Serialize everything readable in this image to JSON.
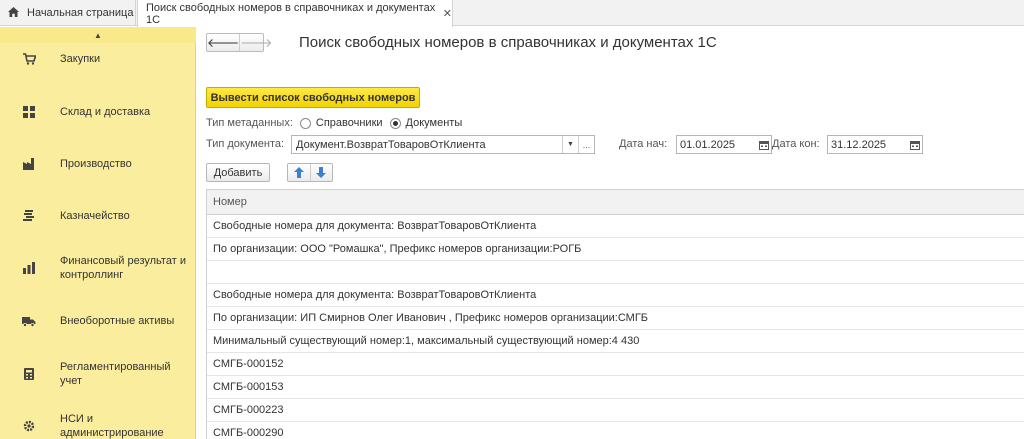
{
  "tabs": {
    "home_label": "Начальная страница",
    "active_label": "Поиск свободных номеров в  справочниках и документах 1С"
  },
  "sidebar": {
    "items": [
      {
        "label": "Закупки",
        "icon": "cart-icon"
      },
      {
        "label": "Склад и доставка",
        "icon": "warehouse-icon"
      },
      {
        "label": "Производство",
        "icon": "factory-icon"
      },
      {
        "label": "Казначейство",
        "icon": "coins-icon"
      },
      {
        "label": "Финансовый результат и контроллинг",
        "icon": "chart-icon"
      },
      {
        "label": "Внеоборотные активы",
        "icon": "truck-icon"
      },
      {
        "label": "Регламентированный учет",
        "icon": "calculator-icon"
      },
      {
        "label": "НСИ и администрирование",
        "icon": "gear-icon"
      }
    ]
  },
  "main": {
    "title": "Поиск свободных номеров в  справочниках и документах 1С",
    "primary_button": "Вывести список свободных номеров",
    "metadata_label": "Тип метаданных:",
    "radio_options": [
      {
        "label": "Справочники",
        "selected": false
      },
      {
        "label": "Документы",
        "selected": true
      }
    ],
    "doc_type_label": "Тип документа:",
    "doc_type_value": "Документ.ВозвратТоваровОтКлиента",
    "date_start_label": "Дата нач:",
    "date_start_value": "01.01.2025",
    "date_end_label": "Дата кон:",
    "date_end_value": "31.12.2025",
    "add_button": "Добавить",
    "dots": "...",
    "table": {
      "header": "Номер",
      "rows": [
        "Свободные номера для документа: ВозвратТоваровОтКлиента",
        "По организации: ООО \"Ромашка\", Префикс номеров организации:РОГБ",
        "",
        "Свободные номера для документа: ВозвратТоваровОтКлиента",
        "По организации: ИП Смирнов Олег Иванович , Префикс номеров организации:СМГБ",
        "Минимальный существующий номер:1, максимальный существующий номер:4 430",
        "СМГБ-000152",
        "СМГБ-000153",
        "СМГБ-000223",
        "СМГБ-000290"
      ]
    }
  },
  "colors": {
    "sidebar_bg": "#fbed9e",
    "primary_button": "#f7dc13",
    "arrow_blue": "#3a7fd0"
  }
}
